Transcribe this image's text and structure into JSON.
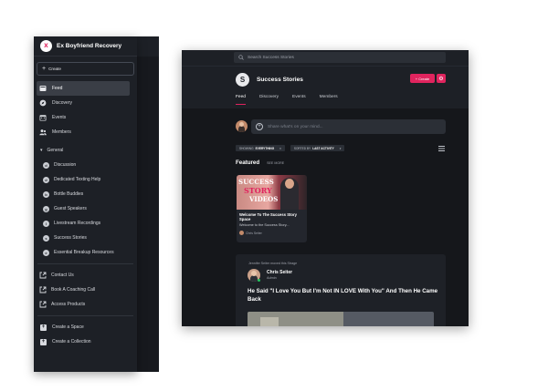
{
  "sidebar": {
    "community_name": "Ex Boyfriend Recovery",
    "logo_text": "X",
    "create_label": "Create",
    "nav": [
      {
        "label": "Feed",
        "icon": "feed-icon",
        "active": true
      },
      {
        "label": "Discovery",
        "icon": "discovery-icon"
      },
      {
        "label": "Events",
        "icon": "calendar-icon"
      },
      {
        "label": "Members",
        "icon": "members-icon"
      }
    ],
    "section_label": "General",
    "channels": [
      {
        "label": "Discussion",
        "icon": "d"
      },
      {
        "label": "Dedicated Texting Help",
        "icon": "d"
      },
      {
        "label": "Bottle Buddies",
        "icon": "b"
      },
      {
        "label": "Guest Speakers",
        "icon": "g"
      },
      {
        "label": "Livestream Recordings",
        "icon": "l"
      },
      {
        "label": "Success Stories",
        "icon": "s"
      },
      {
        "label": "Essential Breakup Resources",
        "icon": "e"
      }
    ],
    "links": [
      {
        "label": "Contact Us"
      },
      {
        "label": "Book A Coaching Call"
      },
      {
        "label": "Access Products"
      }
    ],
    "actions": [
      {
        "label": "Create a Space"
      },
      {
        "label": "Create a Collection"
      }
    ]
  },
  "main": {
    "search_placeholder": "Search Success Stories",
    "space_initial": "S",
    "space_title": "Success Stories",
    "create_button": "+ Create",
    "tabs": [
      "Feed",
      "Discovery",
      "Events",
      "Members"
    ],
    "composer_placeholder": "Share what's on your mind...",
    "filters": [
      {
        "prefix": "SHOWING",
        "value": "EVERYTHING"
      },
      {
        "prefix": "SORTED BY",
        "value": "LAST ACTIVITY"
      }
    ],
    "featured_title": "Featured",
    "see_more": "SEE MORE",
    "featured_card": {
      "image_text_1": "SUCCESS",
      "image_text_2": "STORY",
      "image_text_3": "VIDEOS",
      "title": "Welcome To The Success Story Space",
      "description": "Welcome to the Success Story...",
      "author": "Chris Seiter"
    },
    "post": {
      "meta": "Jennifer Seiter moved this Strage",
      "author": "Chris Seiter",
      "role": "Admin",
      "title": "He Said \"I Love You But I'm Not IN LOVE With You\" And Then He Came Back"
    }
  },
  "colors": {
    "accent": "#e0245e",
    "sidebar_bg": "#1d2026",
    "main_bg": "#15171b"
  }
}
